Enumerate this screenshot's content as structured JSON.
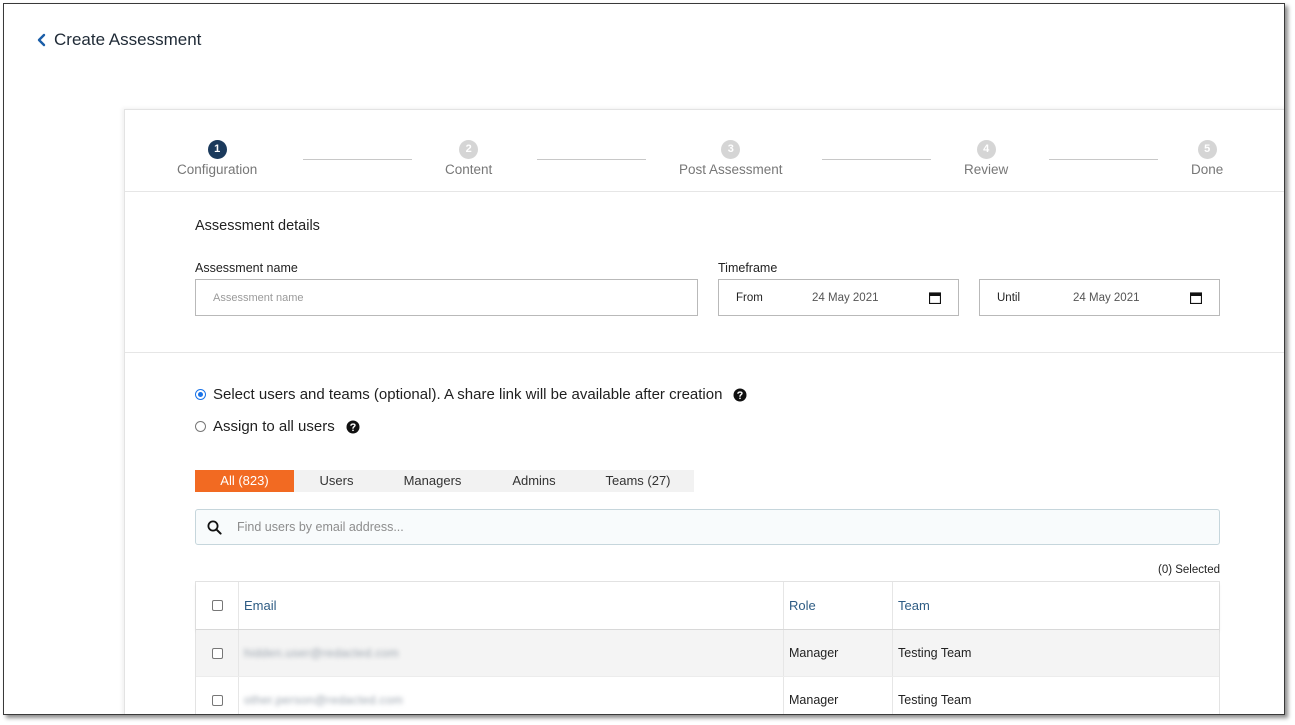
{
  "header": {
    "title": "Create Assessment"
  },
  "stepper": {
    "steps": [
      {
        "number": "1",
        "label": "Configuration"
      },
      {
        "number": "2",
        "label": "Content"
      },
      {
        "number": "3",
        "label": "Post Assessment"
      },
      {
        "number": "4",
        "label": "Review"
      },
      {
        "number": "5",
        "label": "Done"
      }
    ],
    "active_step": 1
  },
  "details": {
    "section_title": "Assessment details",
    "name_label": "Assessment name",
    "name_placeholder": "Assessment name",
    "timeframe_label": "Timeframe",
    "from_label": "From",
    "from_value": "24 May 2021",
    "until_label": "Until",
    "until_value": "24 May 2021"
  },
  "assignment": {
    "option_select": "Select users and teams (optional). A share link will be available after creation",
    "option_all": "Assign to all users",
    "selected_option": "select"
  },
  "tabs": [
    {
      "label": "All (823)",
      "active": true
    },
    {
      "label": "Users",
      "active": false
    },
    {
      "label": "Managers",
      "active": false
    },
    {
      "label": "Admins",
      "active": false
    },
    {
      "label": "Teams (27)",
      "active": false
    }
  ],
  "search": {
    "placeholder": "Find users by email address..."
  },
  "selected_count": "(0) Selected",
  "table": {
    "columns": {
      "email": "Email",
      "role": "Role",
      "team": "Team"
    },
    "rows": [
      {
        "email": "hidden.user@redacted.com",
        "role": "Manager",
        "team": "Testing Team"
      },
      {
        "email": "other.person@redacted.com",
        "role": "Manager",
        "team": "Testing Team"
      }
    ]
  },
  "colors": {
    "accent": "#f26a22",
    "step_active": "#1b3a5c",
    "link": "#2e5c84",
    "radio": "#1a73e8"
  }
}
